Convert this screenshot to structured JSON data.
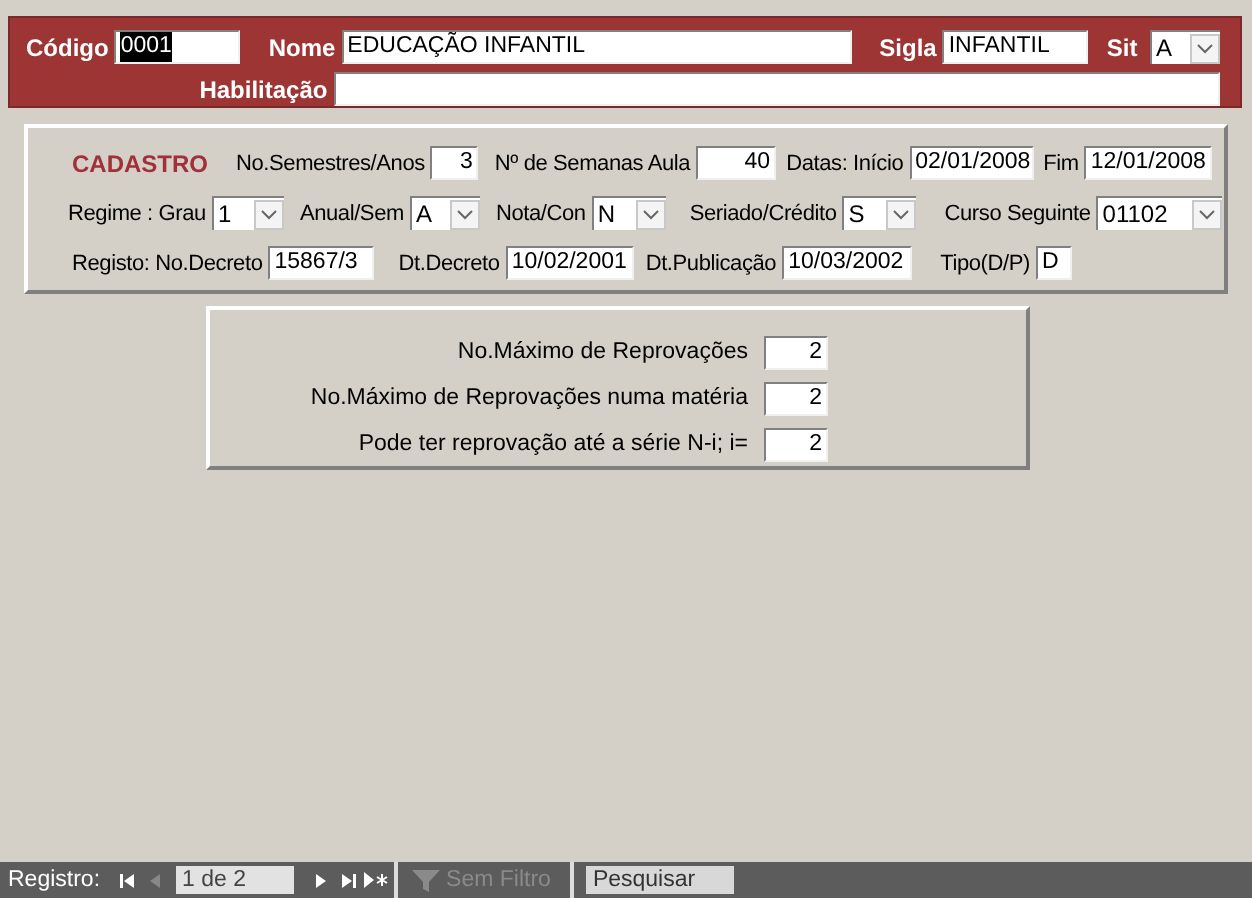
{
  "header": {
    "codigo": {
      "label": "Código",
      "value": "0001",
      "selected": true
    },
    "nome": {
      "label": "Nome",
      "value": "EDUCAÇÃO INFANTIL"
    },
    "sigla": {
      "label": "Sigla",
      "value": "INFANTIL"
    },
    "sit": {
      "label": "Sit",
      "value": "A"
    },
    "habilitacao": {
      "label": "Habilitação"
    }
  },
  "cadastro": {
    "title": "CADASTRO",
    "duracao": [
      {
        "label": "No.Semestres/Anos",
        "value": "3",
        "kind": "number"
      },
      {
        "label": "Nº de Semanas Aula",
        "value": "40",
        "kind": "number"
      },
      {
        "label": "Datas: Início",
        "value": "02/01/2008",
        "kind": "text"
      },
      {
        "label": "Fim",
        "value": "12/01/2008",
        "kind": "text"
      }
    ],
    "regime": [
      {
        "label": "Regime : Grau",
        "value": "1",
        "kind": "combo"
      },
      {
        "label": "Anual/Sem",
        "value": "A",
        "kind": "combo"
      },
      {
        "label": "Nota/Con",
        "value": "N",
        "kind": "combo"
      },
      {
        "label": "Seriado/Crédito",
        "value": "S",
        "kind": "combo"
      },
      {
        "label": "Curso Seguinte",
        "value": "01102",
        "kind": "combo"
      }
    ],
    "registo": [
      {
        "label": "Registo: No.Decreto",
        "value": "15867/3",
        "kind": "text"
      },
      {
        "label": "Dt.Decreto",
        "value": "10/02/2001",
        "kind": "text"
      },
      {
        "label": "Dt.Publicação",
        "value": "10/03/2002",
        "kind": "text"
      },
      {
        "label": "Tipo(D/P)",
        "value": "D",
        "kind": "text"
      }
    ]
  },
  "reprovacoes": [
    {
      "label": "No.Máximo de Reprovações",
      "value": "2"
    },
    {
      "label": "No.Máximo de Reprovações numa matéria",
      "value": "2"
    },
    {
      "label": "Pode ter reprovação até a série N-i; i=",
      "value": "2"
    }
  ],
  "status_bar": {
    "label": "Registro:",
    "position": "1 de 2",
    "filter": {
      "label": "Sem Filtro",
      "disabled": true
    },
    "search": {
      "placeholder": "Pesquisar"
    }
  }
}
